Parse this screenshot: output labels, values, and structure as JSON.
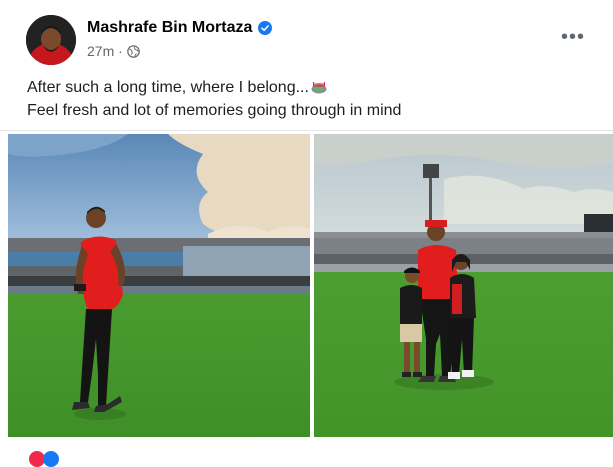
{
  "post": {
    "author": "Mashrafe Bin Mortaza",
    "timestamp": "27m ·",
    "line1": "After such a long time, where I belong...",
    "line2": "Feel fresh and lot of memories going through in mind",
    "more_label": "•••"
  },
  "icons": {
    "verified": "verified-badge-icon",
    "audience": "globe-icon",
    "more": "more-options-icon",
    "emoji": "stadium-emoji"
  },
  "colors": {
    "verified_blue": "#1877f2",
    "meta_gray": "#65676b",
    "jersey_red": "#e01e1e",
    "pitch_green": "#3f9a2e"
  }
}
